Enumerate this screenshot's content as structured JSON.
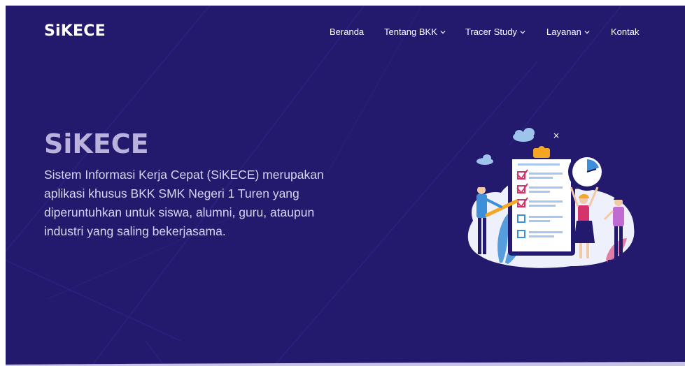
{
  "brand": {
    "logo": "SiKECE"
  },
  "nav": {
    "items": [
      {
        "label": "Beranda",
        "has_dropdown": false
      },
      {
        "label": "Tentang BKK",
        "has_dropdown": true
      },
      {
        "label": "Tracer Study",
        "has_dropdown": true
      },
      {
        "label": "Layanan",
        "has_dropdown": true
      },
      {
        "label": "Kontak",
        "has_dropdown": false
      }
    ]
  },
  "hero": {
    "title": "SiKECE",
    "description": "Sistem Informasi Kerja Cepat (SiKECE) merupakan aplikasi khusus BKK SMK Negeri 1 Turen yang diperuntuhkan untuk siswa, alumni, guru, ataupun industri yang saling bekerjasama."
  },
  "colors": {
    "background": "#231a6e",
    "text": "#ffffff",
    "title": "#b9b2dc",
    "accent_pink": "#d6336c",
    "accent_orange": "#f5a623",
    "accent_blue": "#3c8fd8"
  },
  "icons": {
    "dropdown": "chevron-down-icon",
    "illustration": "checklist-team-illustration"
  }
}
